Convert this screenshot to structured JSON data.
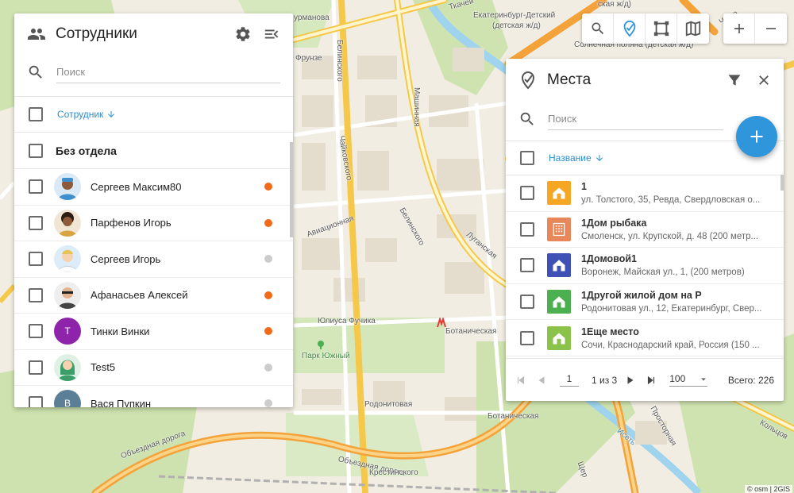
{
  "map": {
    "streets": [
      {
        "id": "lbl-urmanova",
        "text": "урманова"
      },
      {
        "id": "lbl-belinskogo1",
        "text": "Белинского"
      },
      {
        "id": "lbl-mashinnaya",
        "text": "Машинная"
      },
      {
        "id": "lbl-frunze",
        "text": "Фрунзе"
      },
      {
        "id": "lbl-chaikovskogo",
        "text": "Чайковского"
      },
      {
        "id": "lbl-aviacionnaya",
        "text": "Авиационная"
      },
      {
        "id": "lbl-belinskogo2",
        "text": "Белинского"
      },
      {
        "id": "lbl-luganskaya",
        "text": "Луганская"
      },
      {
        "id": "lbl-yuliusa",
        "text": "Юлиуса Фучика"
      },
      {
        "id": "lbl-botanicheskaya1",
        "text": "Ботаническая"
      },
      {
        "id": "lbl-park",
        "text": "Парк Южный"
      },
      {
        "id": "lbl-rodonitovaya",
        "text": "Родонитовая"
      },
      {
        "id": "lbl-botanicheskaya2",
        "text": "Ботаническая"
      },
      {
        "id": "lbl-prostornaya",
        "text": "Просторная"
      },
      {
        "id": "lbl-obezdnaya1",
        "text": "Объездная дорога"
      },
      {
        "id": "lbl-obezdnaya2",
        "text": "Объездная дорога"
      },
      {
        "id": "lbl-krestinskogo",
        "text": "Крестинского"
      },
      {
        "id": "lbl-iset",
        "text": "Исеть"
      },
      {
        "id": "lbl-kolcov",
        "text": "Кольцов"
      },
      {
        "id": "lbl-chelyu",
        "text": "Челю"
      },
      {
        "id": "lbl-tkachey",
        "text": "Ткачей"
      },
      {
        "id": "lbl-ekb-detsky",
        "text": "Екатеринбург-Детский"
      },
      {
        "id": "lbl-ekb-detsky2",
        "text": "(детская ж/д)"
      },
      {
        "id": "lbl-zhd",
        "text": "ская ж/д)"
      },
      {
        "id": "lbl-solnechnaya",
        "text": "Солнечная поляна (детская ж/д)"
      },
      {
        "id": "lbl-scher",
        "text": "Щер"
      }
    ],
    "attribution": "© osm | 2GIS"
  },
  "employees": {
    "title": "Сотрудники",
    "search_placeholder": "Поиск",
    "sort_label": "Сотрудник",
    "group": "Без отдела",
    "items": [
      {
        "name": "Сергеев Максим80",
        "status_color": "#f06a1a",
        "avatar": "doctor-icon",
        "avatar_bg": "#7fb3d5"
      },
      {
        "name": "Парфенов Игорь",
        "status_color": "#f06a1a",
        "avatar": "man-curly-icon",
        "avatar_bg": "#e0c9a6"
      },
      {
        "name": "Сергеев Игорь",
        "status_color": "#cccccc",
        "avatar": "man-blond-icon",
        "avatar_bg": "#cfe3f2"
      },
      {
        "name": "Афанасьев Алексей",
        "status_color": "#f06a1a",
        "avatar": "man-sunglasses-icon",
        "avatar_bg": "#e8e8e8"
      },
      {
        "name": "Тинки Винки",
        "status_color": "#f06a1a",
        "avatar": "T",
        "avatar_bg": "#8e24aa"
      },
      {
        "name": "Test5",
        "status_color": "#cccccc",
        "avatar": "woman-green-icon",
        "avatar_bg": "#cfe8d9"
      },
      {
        "name": "Вася Пупкин",
        "status_color": "#cccccc",
        "avatar": "В",
        "avatar_bg": "#5a7f96"
      }
    ]
  },
  "toolbar": {
    "buttons": [
      "search-icon",
      "places-icon",
      "polygon-icon",
      "map-layers-icon"
    ],
    "zoom": [
      "+",
      "−"
    ]
  },
  "places": {
    "title": "Места",
    "search_placeholder": "Поиск",
    "sort_label": "Название",
    "items": [
      {
        "title": "1",
        "address": "ул. Толстого, 35, Ревда, Свердловская о...",
        "icon_color": "#f5a623",
        "icon": "house-icon"
      },
      {
        "title": "1Дом рыбака",
        "address": "Смоленск, ул. Крупской, д. 48 (200 метр...",
        "icon_color": "#e8885a",
        "icon": "building-icon"
      },
      {
        "title": "1Домовой1",
        "address": "Воронеж, Майская ул., 1, (200 метров)",
        "icon_color": "#3f51b5",
        "icon": "house-icon"
      },
      {
        "title": "1Другой жилой дом на Р",
        "address": "Родонитовая ул., 12, Екатеринбург, Свер...",
        "icon_color": "#4caf50",
        "icon": "house-icon"
      },
      {
        "title": "1Еще место",
        "address": "Сочи, Краснодарский край, Россия (150 ...",
        "icon_color": "#8bc34a",
        "icon": "house-icon"
      }
    ],
    "pager": {
      "page": "1",
      "of": "1 из 3",
      "size": "100",
      "total": "Всего: 226"
    }
  }
}
